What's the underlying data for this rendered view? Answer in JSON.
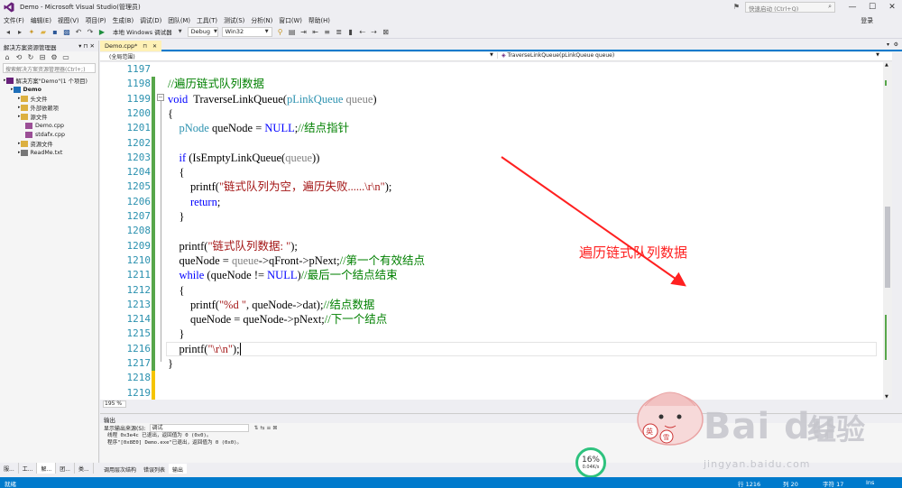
{
  "titlebar": {
    "title": "Demo - Microsoft Visual Studio(管理员)",
    "quick_launch_placeholder": "快速启动 (Ctrl+Q)",
    "minimize": "—",
    "restore": "☐",
    "close": "✕"
  },
  "menu": {
    "items": [
      "文件(F)",
      "编辑(E)",
      "视图(V)",
      "项目(P)",
      "生成(B)",
      "调试(D)",
      "团队(M)",
      "工具(T)",
      "测试(S)",
      "分析(N)",
      "窗口(W)",
      "帮助(H)"
    ],
    "login": "登录"
  },
  "toolbar": {
    "run_label": "本地 Windows 调试器",
    "config": "Debug",
    "platform": "Win32"
  },
  "solution_explorer": {
    "title": "解决方案资源管理器",
    "search_placeholder": "搜索解决方案资源管理器(Ctrl+;)",
    "tree": [
      {
        "label": "解决方案\"Demo\"(1 个项目)",
        "indent": 0,
        "icon": "solution-icon"
      },
      {
        "label": "Demo",
        "indent": 1,
        "icon": "project-icon",
        "selected": true
      },
      {
        "label": "头文件",
        "indent": 2,
        "icon": "folder-icon"
      },
      {
        "label": "外部依赖项",
        "indent": 2,
        "icon": "folder-icon"
      },
      {
        "label": "源文件",
        "indent": 2,
        "icon": "folder-icon"
      },
      {
        "label": "Demo.cpp",
        "indent": 3,
        "icon": "cpp-file-icon"
      },
      {
        "label": "stdafx.cpp",
        "indent": 3,
        "icon": "cpp-file-icon"
      },
      {
        "label": "资源文件",
        "indent": 2,
        "icon": "folder-icon"
      },
      {
        "label": "ReadMe.txt",
        "indent": 2,
        "icon": "text-file-icon"
      }
    ],
    "bottom_tabs": [
      "服...",
      "工...",
      "解...",
      "团...",
      "类..."
    ]
  },
  "editor": {
    "tab_label": "Demo.cpp*",
    "scope": "(全局范围)",
    "function": "TraverseLinkQueue(pLinkQueue queue)",
    "zoom": "195 %",
    "line_numbers": [
      "1197",
      "1198",
      "1199",
      "1200",
      "1201",
      "1202",
      "1203",
      "1204",
      "1205",
      "1206",
      "1207",
      "1208",
      "1209",
      "1210",
      "1211",
      "1212",
      "1213",
      "1214",
      "1215",
      "1216",
      "1217",
      "1218",
      "1219"
    ],
    "code": [
      [],
      [
        [
          "cm",
          "//遍历链式队列数据"
        ]
      ],
      [
        [
          "kw",
          "void"
        ],
        [
          "",
          "  TraverseLinkQueue("
        ],
        [
          "ty",
          "pLinkQueue"
        ],
        [
          "pm",
          " queue"
        ],
        [
          "",
          ")"
        ]
      ],
      [
        [
          "",
          "{"
        ]
      ],
      [
        [
          "",
          "    "
        ],
        [
          "ty",
          "pNode"
        ],
        [
          "",
          " queNode = "
        ],
        [
          "kw",
          "NULL"
        ],
        [
          "",
          ";"
        ],
        [
          "cm",
          "//结点指针"
        ]
      ],
      [],
      [
        [
          "",
          "    "
        ],
        [
          "kw",
          "if"
        ],
        [
          "",
          " (IsEmptyLinkQueue("
        ],
        [
          "pm",
          "queue"
        ],
        [
          "",
          "))"
        ]
      ],
      [
        [
          "",
          "    {"
        ]
      ],
      [
        [
          "",
          "        printf("
        ],
        [
          "str",
          "\"链式队列为空，遍历失败......\\r\\n\""
        ],
        [
          "",
          ");"
        ]
      ],
      [
        [
          "",
          "        "
        ],
        [
          "kw",
          "return"
        ],
        [
          "",
          ";"
        ]
      ],
      [
        [
          "",
          "    }"
        ]
      ],
      [],
      [
        [
          "",
          "    printf("
        ],
        [
          "str",
          "\"链式队列数据: \""
        ],
        [
          "",
          ");"
        ]
      ],
      [
        [
          "",
          "    queNode = "
        ],
        [
          "pm",
          "queue"
        ],
        [
          "",
          "->qFront->pNext;"
        ],
        [
          "cm",
          "//第一个有效结点"
        ]
      ],
      [
        [
          "",
          "    "
        ],
        [
          "kw",
          "while"
        ],
        [
          "",
          " (queNode != "
        ],
        [
          "kw",
          "NULL"
        ],
        [
          "",
          ")"
        ],
        [
          "cm",
          "//最后一个结点结束"
        ]
      ],
      [
        [
          "",
          "    {"
        ]
      ],
      [
        [
          "",
          "        printf("
        ],
        [
          "str",
          "\"%d \""
        ],
        [
          "",
          ", queNode->dat);"
        ],
        [
          "cm",
          "//结点数据"
        ]
      ],
      [
        [
          "",
          "        queNode = queNode->pNext;"
        ],
        [
          "cm",
          "//下一个结点"
        ]
      ],
      [
        [
          "",
          "    }"
        ]
      ],
      [
        [
          "",
          "    printf("
        ],
        [
          "str",
          "\"\\r\\n\""
        ],
        [
          "",
          ");"
        ]
      ],
      [
        [
          "",
          "}"
        ]
      ],
      [],
      []
    ]
  },
  "annotation": "遍历链式队列数据",
  "output": {
    "title": "输出",
    "source_label": "显示输出来源(S):",
    "source_value": "调试",
    "lines": [
      "线程 0x3e4c 已退出，返回值为 0 (0x0)。",
      "程序\"[0x8E0] Demo.exe\"已退出，返回值为 0 (0x0)。"
    ],
    "bottom_tabs": [
      "调用层次结构",
      "错误列表",
      "输出"
    ]
  },
  "progress": {
    "percent": "16%",
    "speed": "0.04K/s"
  },
  "watermark": {
    "brand": "Bai du",
    "product": "经验",
    "url": "jingyan.baidu.com"
  },
  "status": {
    "ready": "就绪",
    "line": "行 1216",
    "col": "列 20",
    "ch": "字符 17",
    "mode": "Ins"
  }
}
